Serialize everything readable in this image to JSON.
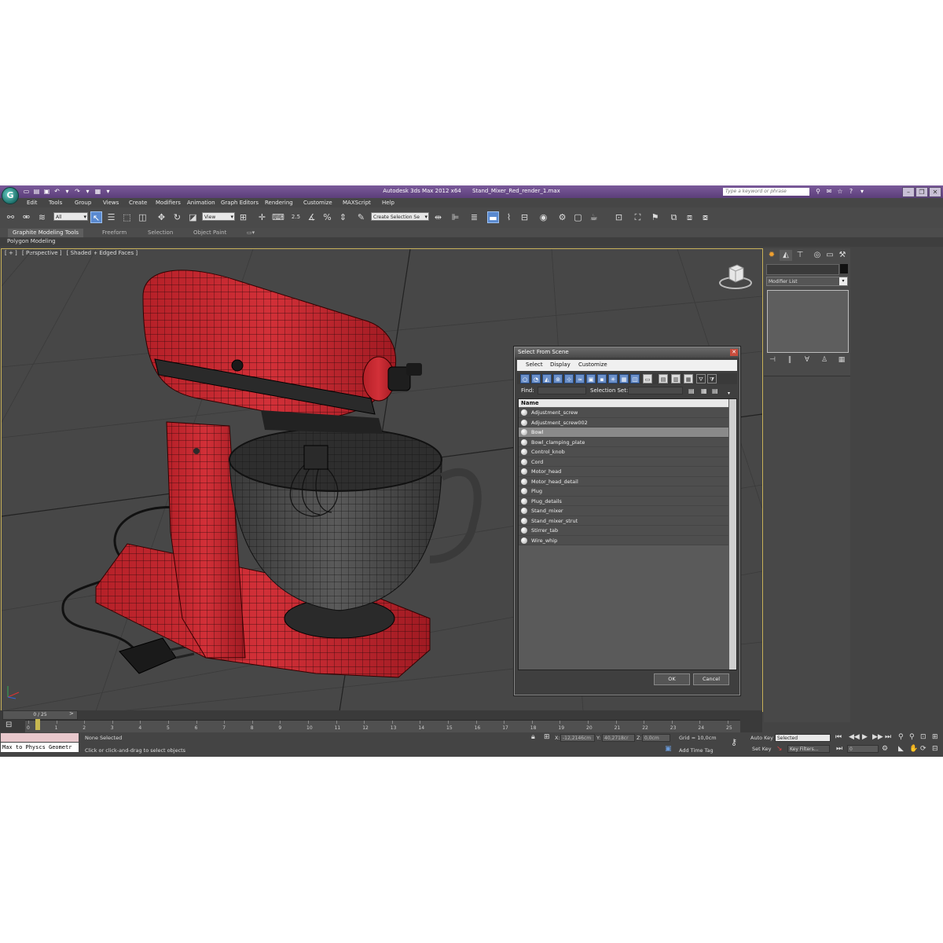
{
  "titlebar": {
    "app_name": "Autodesk 3ds Max  2012 x64",
    "file_name": "Stand_Mixer_Red_render_1.max",
    "search_placeholder": "Type a keyword or phrase",
    "quick_access_icons": [
      "new-icon",
      "open-icon",
      "save-icon",
      "undo-icon",
      "redo-icon",
      "project-folder-icon"
    ]
  },
  "menu": [
    "Edit",
    "Tools",
    "Group",
    "Views",
    "Create",
    "Modifiers",
    "Animation",
    "Graph Editors",
    "Rendering",
    "Customize",
    "MAXScript",
    "Help"
  ],
  "toolbar": {
    "selection_filter": "All",
    "reference_coord": "View",
    "named_selection": "Create Selection Se",
    "snap_value": "2.5"
  },
  "ribbon": {
    "tabs": [
      "Graphite Modeling Tools",
      "Freeform",
      "Selection",
      "Object Paint"
    ],
    "active_panel": "Polygon Modeling"
  },
  "viewport": {
    "labels": [
      "[ + ]",
      "[ Perspective ]",
      "[ Shaded + Edged Faces ]"
    ],
    "viewcube_icon": "viewcube-icon"
  },
  "command_panel": {
    "tabs": [
      "create-icon",
      "modify-icon",
      "hierarchy-icon",
      "motion-icon",
      "display-icon",
      "utilities-icon"
    ],
    "modifier_list": "Modifier List"
  },
  "dialog": {
    "title": "Select From Scene",
    "menu": [
      "Select",
      "Display",
      "Customize"
    ],
    "find_label": "Find:",
    "selection_set_label": "Selection Set:",
    "column_header": "Name",
    "items": [
      {
        "name": "Adjustment_screw",
        "selected": false
      },
      {
        "name": "Adjustment_screw002",
        "selected": false
      },
      {
        "name": "Bowl",
        "selected": true
      },
      {
        "name": "Bowl_clamping_plate",
        "selected": false
      },
      {
        "name": "Control_knob",
        "selected": false
      },
      {
        "name": "Cord",
        "selected": false
      },
      {
        "name": "Motor_head",
        "selected": false
      },
      {
        "name": "Motor_head_detail",
        "selected": false
      },
      {
        "name": "Plug",
        "selected": false
      },
      {
        "name": "Plug_details",
        "selected": false
      },
      {
        "name": "Stand_mixer",
        "selected": false
      },
      {
        "name": "Stand_mixer_strut",
        "selected": false
      },
      {
        "name": "Stirrer_tab",
        "selected": false
      },
      {
        "name": "Wire_whip",
        "selected": false
      }
    ],
    "ok_label": "OK",
    "cancel_label": "Cancel"
  },
  "timeline": {
    "slider_label": "0 / 25",
    "ticks": [
      "0",
      "1",
      "2",
      "3",
      "4",
      "5",
      "6",
      "7",
      "8",
      "9",
      "10",
      "11",
      "12",
      "13",
      "14",
      "15",
      "16",
      "17",
      "18",
      "19",
      "20",
      "21",
      "22",
      "23",
      "24",
      "25"
    ]
  },
  "status": {
    "maxscript_text": "Max to Physcs Geometr",
    "selection_text": "None Selected",
    "prompt_text": "Click or click-and-drag to select objects",
    "x_label": "X:",
    "x_value": "-12,2146cm",
    "y_label": "Y:",
    "y_value": "40,2718cr",
    "z_label": "Z:",
    "z_value": "0,0cm",
    "grid_text": "Grid = 10,0cm",
    "add_time_tag": "Add Time Tag",
    "auto_key": "Auto Key",
    "set_key": "Set Key",
    "key_mode": "Selected",
    "key_filters": "Key Filters...",
    "frame_value": "0"
  },
  "colors": {
    "title_purple": "#6a4b8a",
    "mixer_red": "#c2262d",
    "viewport_bg": "#474747",
    "selection_blue": "#5a8ad0"
  }
}
